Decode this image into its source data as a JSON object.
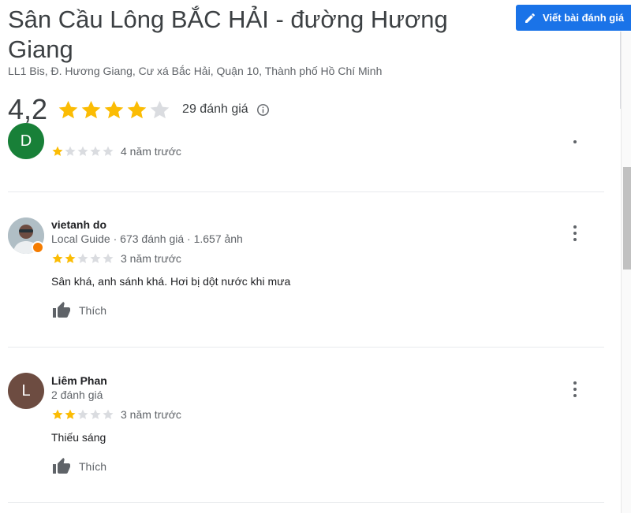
{
  "place": {
    "name": "Sân Cầu Lông BẮC HẢI - đường Hương Giang",
    "address": "LL1 Bis, Đ. Hương Giang, Cư xá Bắc Hải, Quận 10, Thành phố Hồ Chí Minh",
    "rating": "4,2",
    "rating_fraction": 0.84,
    "review_count": "29 đánh giá"
  },
  "write_review_label": "Viết bài đánh giá",
  "colors": {
    "accent": "#1a73e8",
    "star": "#fbbc04",
    "star_empty": "#dadce0"
  },
  "reviews": [
    {
      "initial": "D",
      "avatar_color": "#188038",
      "stars": 1,
      "time": "4 năm trước"
    },
    {
      "name": "vietanh do",
      "meta": "Local Guide · 673 đánh giá · 1.657 ảnh",
      "stars": 2,
      "time": "3 năm trước",
      "text": "Sân khá, anh sánh khá. Hơi bị dột nước khi mưa",
      "like_label": "Thích"
    },
    {
      "name": "Liêm Phan",
      "initial": "L",
      "avatar_color": "#6d4c41",
      "meta": "2 đánh giá",
      "stars": 2,
      "time": "3 năm trước",
      "text": "Thiếu sáng",
      "like_label": "Thích"
    }
  ]
}
